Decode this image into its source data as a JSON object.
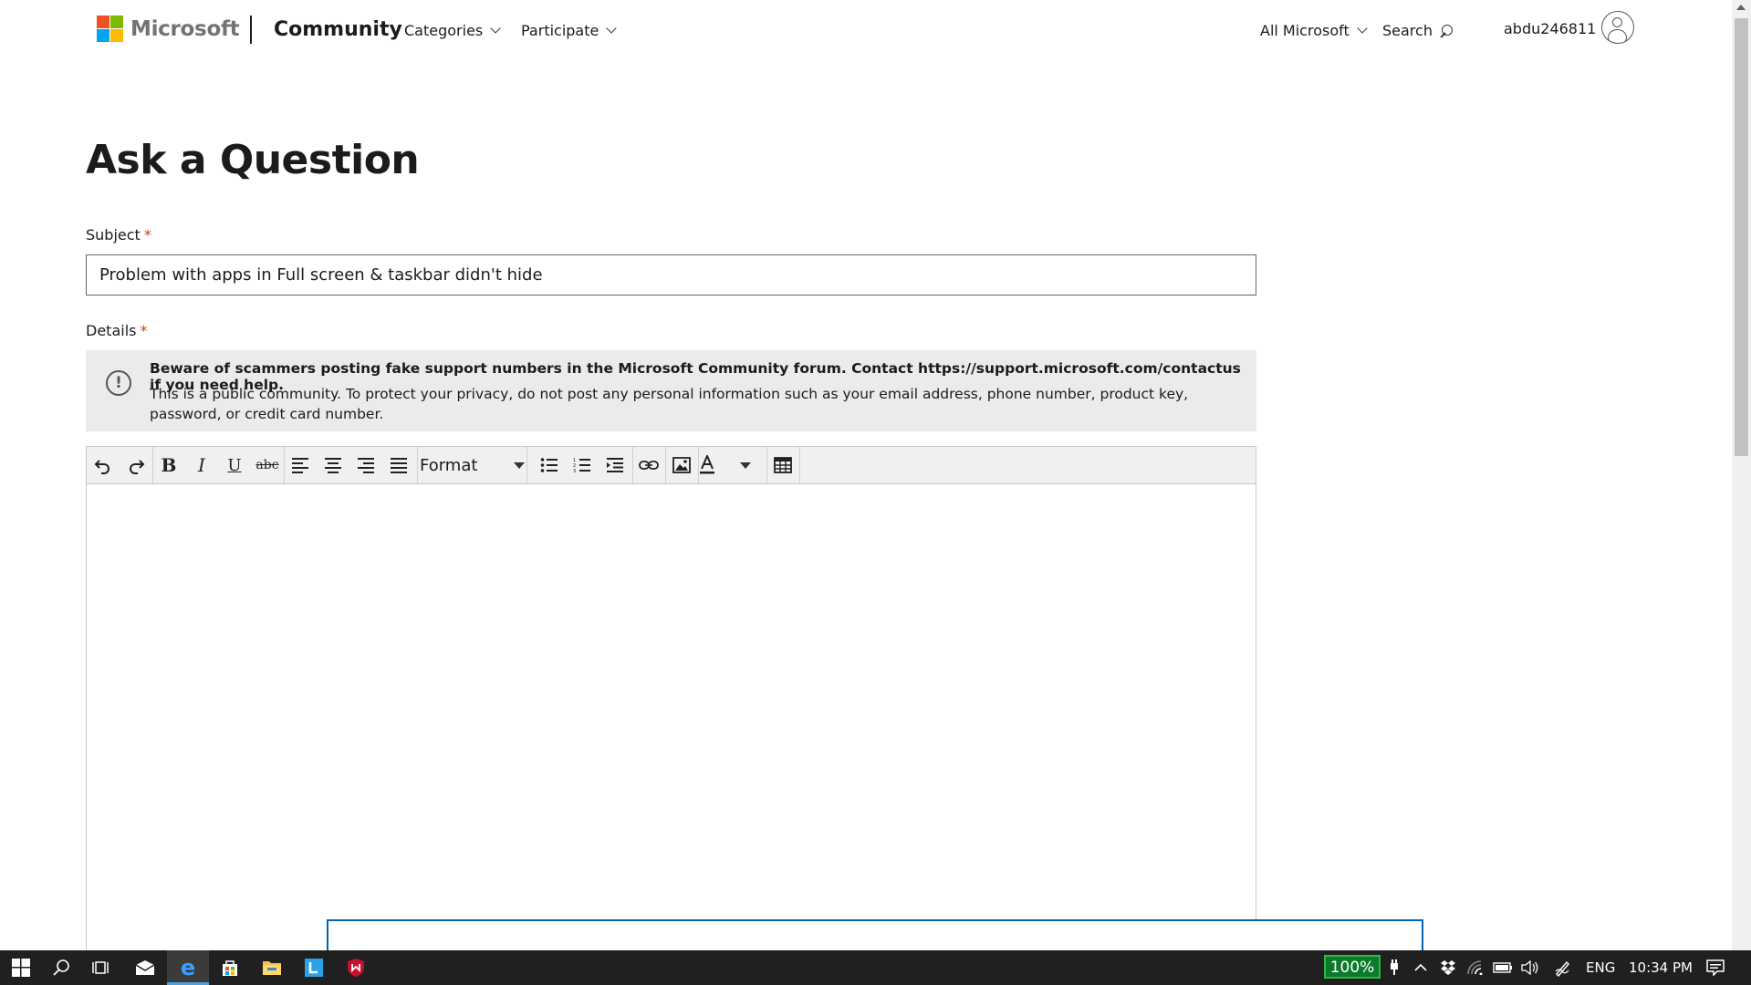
{
  "header": {
    "logo_text": "Microsoft",
    "logo_colors": [
      "#f25022",
      "#7fba00",
      "#00a4ef",
      "#ffb900"
    ],
    "brand": "Community",
    "nav": [
      "Categories",
      "Participate"
    ],
    "all_microsoft": "All Microsoft",
    "search_label": "Search",
    "username": "abdu246811"
  },
  "form": {
    "title": "Ask a Question",
    "subject_label": "Subject",
    "required_mark": "*",
    "subject_value": "Problem with apps in Full screen & taskbar didn't hide",
    "details_label": "Details",
    "notice_title": "Beware of scammers posting fake support numbers in the Microsoft Community forum. Contact https://support.microsoft.com/contactus if you need help.",
    "notice_body": "This is a public community. To protect your privacy, do not post any personal information such as your email address, phone number, product key, password, or credit card number."
  },
  "editor": {
    "format_label": "Format",
    "buttons": [
      "undo",
      "redo",
      "bold",
      "italic",
      "underline",
      "strikethrough",
      "align-left",
      "align-center",
      "align-right",
      "justify",
      "format",
      "bullet-list",
      "numbered-list",
      "indent",
      "link",
      "image",
      "text-color",
      "table"
    ]
  },
  "taskbar": {
    "battery_percent": "100%",
    "language": "ENG",
    "time": "10:34 PM"
  },
  "colors": {
    "required": "#d83b01",
    "taskbar_bg": "#202020",
    "active_accent": "#4ca0e0",
    "battery_green": "#0c7a2b",
    "notif_border": "#0063b1"
  }
}
